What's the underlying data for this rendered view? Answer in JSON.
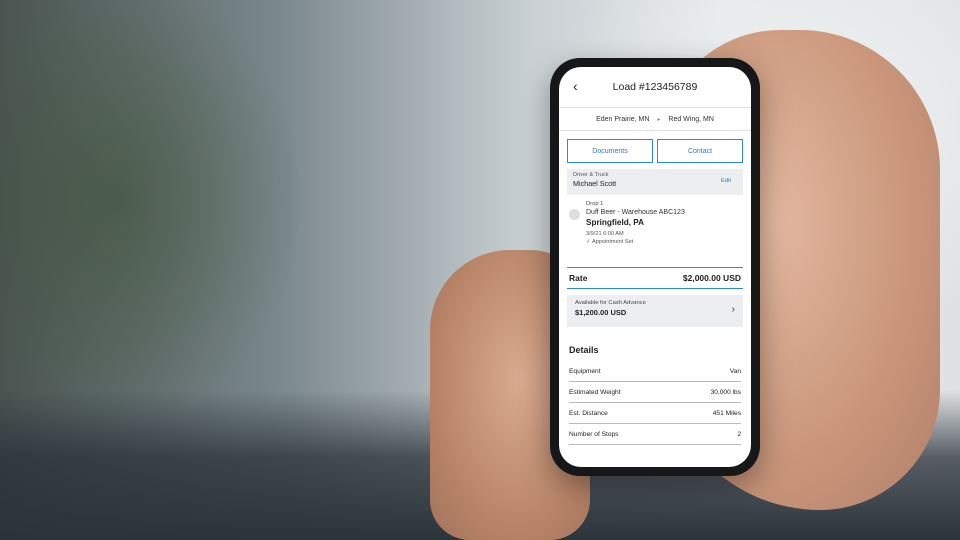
{
  "header": {
    "title": "Load #123456789"
  },
  "route": {
    "origin": "Eden Prairie, MN",
    "destination": "Red Wing, MN"
  },
  "actions": {
    "documents_label": "Documents",
    "contact_label": "Contact"
  },
  "driver": {
    "label": "Driver & Truck",
    "name": "Michael Scott",
    "edit_label": "Edit"
  },
  "drop": {
    "label": "Drop 1",
    "facility": "Duff Beer - Warehouse ABC123",
    "city": "Springfield, PA",
    "datetime": "3/9/21 6:00 AM",
    "appointment": "Appointment Set"
  },
  "rate": {
    "label": "Rate",
    "value": "$2,000.00 USD"
  },
  "cash_advance": {
    "label": "Available for Cash Advance",
    "value": "$1,200.00 USD"
  },
  "details": {
    "title": "Details",
    "rows": [
      {
        "label": "Equipment",
        "value": "Van"
      },
      {
        "label": "Estimated Weight",
        "value": "30,000 lbs"
      },
      {
        "label": "Est. Distance",
        "value": "451 Miles"
      },
      {
        "label": "Number of Stops",
        "value": "2"
      }
    ]
  },
  "icons": {
    "back": "chevron-left-icon",
    "route_arrow": "chevron-right-icon",
    "check": "check-icon",
    "advance": "chevron-right-icon"
  },
  "colors": {
    "accent": "#2b8cc4",
    "panel": "#eceeef"
  }
}
